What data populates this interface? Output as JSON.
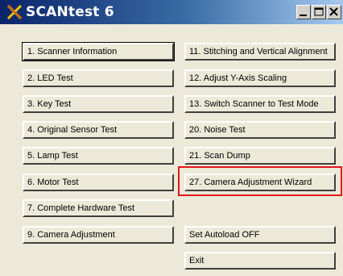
{
  "window": {
    "title": "SCANtest 6",
    "controls": [
      {
        "name": "minimize",
        "icon": "minimize-icon"
      },
      {
        "name": "maximize",
        "icon": "maximize-icon"
      },
      {
        "name": "close",
        "icon": "close-icon"
      }
    ]
  },
  "buttons_left": [
    {
      "label": "1. Scanner Information",
      "default": true
    },
    {
      "label": "2. LED Test"
    },
    {
      "label": "3. Key Test"
    },
    {
      "label": "4. Original Sensor Test"
    },
    {
      "label": "5. Lamp Test"
    },
    {
      "label": "6. Motor Test"
    },
    {
      "label": "7. Complete Hardware Test"
    },
    {
      "label": "9. Camera Adjustment"
    }
  ],
  "buttons_right": [
    {
      "label": "11. Stitching and Vertical Alignment"
    },
    {
      "label": "12. Adjust Y-Axis Scaling"
    },
    {
      "label": "13. Switch Scanner to Test Mode"
    },
    {
      "label": "20. Noise Test"
    },
    {
      "label": "21. Scan Dump"
    },
    {
      "label": "27. Camera Adjustment Wizard",
      "highlighted": true
    },
    {
      "label": "Set Autoload OFF"
    },
    {
      "label": "Exit"
    }
  ],
  "colors": {
    "highlight": "#e0141c",
    "titlebar_start": "#0a246a",
    "titlebar_end": "#a6caf0",
    "window_bg": "#ece9d8"
  }
}
